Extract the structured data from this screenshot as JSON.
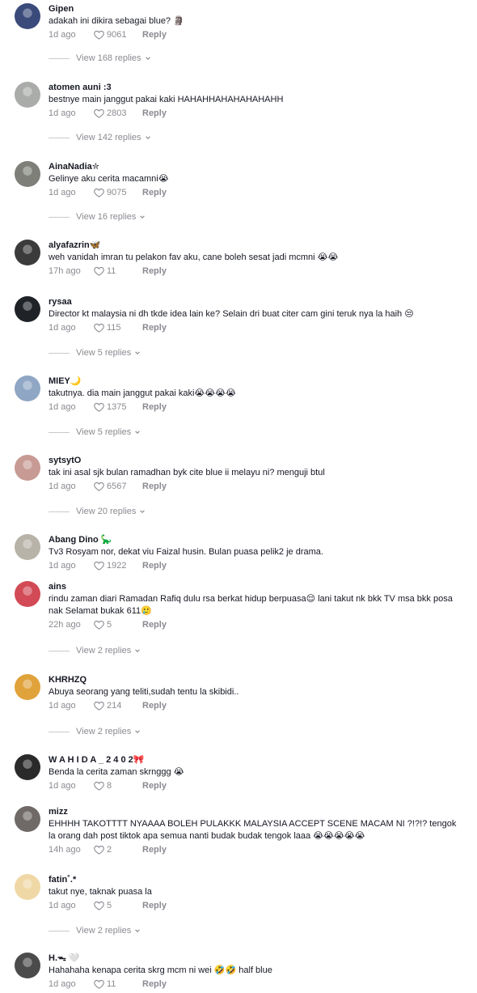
{
  "comments": [
    {
      "username": "Gipen",
      "text": "adakah ini dikira sebagai blue? 🗿",
      "time": "1d ago",
      "likes": "9061",
      "reply": "Reply",
      "view_replies": "View 168 replies",
      "avatar_color": "#3a4a7a"
    },
    {
      "username": "atomen auni :3",
      "text": "bestnye main janggut pakai kaki HAHAHHAHAHAHAHAHH",
      "time": "1d ago",
      "likes": "2803",
      "reply": "Reply",
      "view_replies": "View 142 replies",
      "avatar_color": "#a9aca9"
    },
    {
      "username": "AinaNadia✮",
      "text": "Gelinye aku cerita macamni😭",
      "time": "1d ago",
      "likes": "9075",
      "reply": "Reply",
      "view_replies": "View 16 replies",
      "avatar_color": "#7d7f78"
    },
    {
      "username": "alyafazrin🦋",
      "text": "weh vanidah imran tu pelakon fav aku, cane boleh sesat jadi mcmni 😭😭",
      "time": "17h ago",
      "likes": "11",
      "reply": "Reply",
      "view_replies": "",
      "avatar_color": "#3b3b3b"
    },
    {
      "username": "rysaa",
      "text": "Director kt malaysia ni dh tkde idea lain ke? Selain dri buat citer cam gini teruk nya la haih 😒",
      "time": "1d ago",
      "likes": "115",
      "reply": "Reply",
      "view_replies": "View 5 replies",
      "avatar_color": "#1f2328"
    },
    {
      "username": "MIEY🌙",
      "text": "takutnya. dia main janggut pakai kaki😭😭😭😭",
      "time": "1d ago",
      "likes": "1375",
      "reply": "Reply",
      "view_replies": "View 5 replies",
      "avatar_color": "#8fa6c4"
    },
    {
      "username": "sytsytO",
      "text": "tak ini asal sjk bulan ramadhan byk cite blue ii melayu ni? menguji btul",
      "time": "1d ago",
      "likes": "6567",
      "reply": "Reply",
      "view_replies": "View 20 replies",
      "avatar_color": "#c89a94"
    },
    {
      "username": "Abang Dino 🦕",
      "text": "Tv3 Rosyam nor, dekat viu Faizal husin. Bulan puasa pelik2 je drama.",
      "time": "1d ago",
      "likes": "1922",
      "reply": "Reply",
      "view_replies": "",
      "avatar_color": "#b8b3a8"
    },
    {
      "username": "ains",
      "text": "rindu zaman diari Ramadan Rafiq dulu rsa berkat hidup berpuasa😌 lani takut nk bkk TV msa bkk posa nak Selamat bukak 611🥲",
      "time": "22h ago",
      "likes": "5",
      "reply": "Reply",
      "view_replies": "View 2 replies",
      "avatar_color": "#d24a55"
    },
    {
      "username": "KHRHZQ",
      "text": "Abuya seorang yang teliti,sudah tentu la skibidi..",
      "time": "1d ago",
      "likes": "214",
      "reply": "Reply",
      "view_replies": "View 2 replies",
      "avatar_color": "#e0a23a"
    },
    {
      "username": "W A H I D A _ 2 4 0 2🎀",
      "text": "Benda la cerita zaman skrnggg 😭",
      "time": "1d ago",
      "likes": "8",
      "reply": "Reply",
      "view_replies": "",
      "avatar_color": "#2b2a2a"
    },
    {
      "username": "mizz",
      "text": "EHHHH TAKOTTTT NYAAAA BOLEH PULAKKK MALAYSIA ACCEPT SCENE MACAM NI ?!?!? tengok la orang dah post tiktok apa semua nanti budak budak tengok laaa 😭😭😭😭😭",
      "time": "14h ago",
      "likes": "2",
      "reply": "Reply",
      "view_replies": "",
      "avatar_color": "#6f6a68"
    },
    {
      "username": "fatin˚.*",
      "text": "takut nye, taknak puasa la",
      "time": "1d ago",
      "likes": "5",
      "reply": "Reply",
      "view_replies": "View 2 replies",
      "avatar_color": "#f0d8a6"
    },
    {
      "username": "H.ᯓ 🤍",
      "text": "Hahahaha kenapa cerita skrg mcm ni wei 🤣🤣 half blue",
      "time": "1d ago",
      "likes": "11",
      "reply": "Reply",
      "view_replies": "",
      "avatar_color": "#4b4b4b"
    }
  ]
}
